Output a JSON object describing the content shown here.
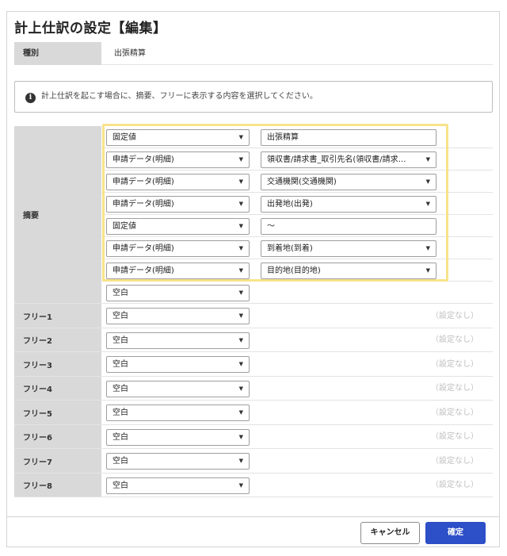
{
  "dialog": {
    "title": "計上仕訳の設定【編集】",
    "kind": {
      "label": "種別",
      "value": "出張精算"
    },
    "info": {
      "icon": "info-icon",
      "text": "計上仕訳を起こす場合に、摘要、フリーに表示する内容を選択してください。"
    },
    "summary": {
      "label": "摘要",
      "items": [
        {
          "source": "固定値",
          "value": "出張精算",
          "value_type": "text"
        },
        {
          "source": "申請データ(明細)",
          "value": "領収書/請求書_取引先名(領収書/請求…",
          "value_type": "select"
        },
        {
          "source": "申請データ(明細)",
          "value": "交通機関(交通機関)",
          "value_type": "select"
        },
        {
          "source": "申請データ(明細)",
          "value": "出発地(出発)",
          "value_type": "select"
        },
        {
          "source": "固定値",
          "value": "～",
          "value_type": "text"
        },
        {
          "source": "申請データ(明細)",
          "value": "到着地(到着)",
          "value_type": "select"
        },
        {
          "source": "申請データ(明細)",
          "value": "目的地(目的地)",
          "value_type": "select"
        },
        {
          "source": "空白"
        }
      ]
    },
    "free_rows": [
      {
        "label": "フリー1",
        "source": "空白",
        "note": "（設定なし）"
      },
      {
        "label": "フリー2",
        "source": "空白",
        "note": "（設定なし）"
      },
      {
        "label": "フリー3",
        "source": "空白",
        "note": "（設定なし）"
      },
      {
        "label": "フリー4",
        "source": "空白",
        "note": "（設定なし）"
      },
      {
        "label": "フリー5",
        "source": "空白",
        "note": "（設定なし）"
      },
      {
        "label": "フリー6",
        "source": "空白",
        "note": "（設定なし）"
      },
      {
        "label": "フリー7",
        "source": "空白",
        "note": "（設定なし）"
      },
      {
        "label": "フリー8",
        "source": "空白",
        "note": "（設定なし）"
      }
    ],
    "buttons": {
      "cancel": "キャンセル",
      "confirm": "確定"
    },
    "colors": {
      "confirm_bg": "#2d4fc8",
      "highlight_border": "#f8e38a",
      "label_bg": "#d9d9d9"
    }
  }
}
